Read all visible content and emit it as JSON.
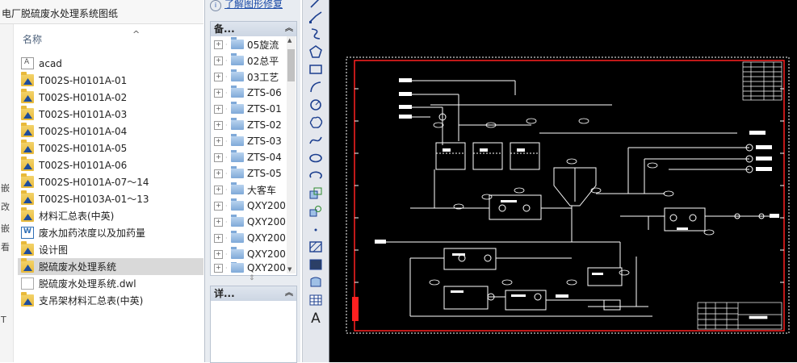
{
  "explorer": {
    "path_title": "电厂脱硫废水处理系统图纸",
    "sort_header": "名称",
    "left_strip_chars": [
      "嵌",
      "改",
      "嵌",
      "看",
      "T"
    ],
    "files": [
      {
        "name": "acad",
        "icon": "dwg-file-icon"
      },
      {
        "name": "T002S-H0101A-01",
        "icon": "cad-folder-icon"
      },
      {
        "name": "T002S-H0101A-02",
        "icon": "cad-folder-icon"
      },
      {
        "name": "T002S-H0101A-03",
        "icon": "cad-folder-icon"
      },
      {
        "name": "T002S-H0101A-04",
        "icon": "cad-folder-icon"
      },
      {
        "name": "T002S-H0101A-05",
        "icon": "cad-folder-icon"
      },
      {
        "name": "T002S-H0101A-06",
        "icon": "cad-folder-icon"
      },
      {
        "name": "T002S-H0101A-07～14",
        "icon": "cad-folder-icon"
      },
      {
        "name": "T002S-H0103A-01～13",
        "icon": "cad-folder-icon"
      },
      {
        "name": "材料汇总表(中英)",
        "icon": "cad-folder-icon"
      },
      {
        "name": "废水加药浓度以及加药量",
        "icon": "word-file-icon"
      },
      {
        "name": "设计图",
        "icon": "cad-folder-icon"
      },
      {
        "name": "脱硫废水处理系统",
        "icon": "cad-folder-icon",
        "selected": true
      },
      {
        "name": "脱硫废水处理系统.dwl",
        "icon": "blank-file-icon"
      },
      {
        "name": "支吊架材料汇总表(中英)",
        "icon": "cad-folder-icon"
      }
    ]
  },
  "midpanel": {
    "top_link": "了解图形修复",
    "backup_pane_title": "备...",
    "detail_pane_title": "详...",
    "tree_items": [
      "05旋流",
      "02总平",
      "03工艺",
      "ZTS-06",
      "ZTS-01",
      "ZTS-02",
      "ZTS-03",
      "ZTS-04",
      "ZTS-05",
      "大客车",
      "QXY200",
      "QXY200",
      "QXY200",
      "QXY200",
      "QXY200"
    ]
  },
  "toolbar": {
    "tools": [
      "line-icon",
      "polyline-icon",
      "construction-line-icon",
      "polygon-icon",
      "rectangle-icon",
      "arc-icon",
      "circle-icon",
      "revision-cloud-icon",
      "spline-icon",
      "ellipse-icon",
      "ellipse-arc-icon",
      "insert-block-icon",
      "make-block-icon",
      "point-icon",
      "hatch-icon",
      "gradient-icon",
      "region-icon",
      "table-icon",
      "multiline-text-icon"
    ],
    "text_tool_label": "A"
  },
  "canvas": {
    "background": "#000000",
    "border_color": "#ff0000",
    "line_color": "#ffffff"
  }
}
